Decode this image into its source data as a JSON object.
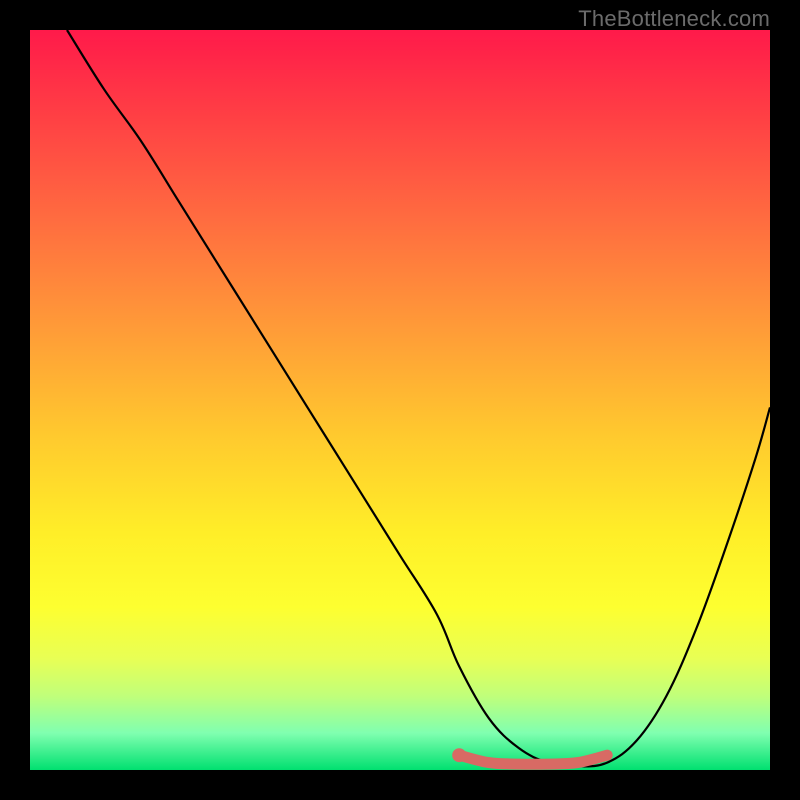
{
  "watermark": "TheBottleneck.com",
  "chart_data": {
    "type": "line",
    "title": "",
    "xlabel": "",
    "ylabel": "",
    "xlim": [
      0,
      100
    ],
    "ylim": [
      0,
      100
    ],
    "grid": false,
    "legend": false,
    "series": [
      {
        "name": "curve",
        "color": "#000000",
        "x": [
          5,
          10,
          15,
          20,
          25,
          30,
          35,
          40,
          45,
          50,
          55,
          58,
          62,
          66,
          70,
          74,
          78,
          82,
          86,
          90,
          94,
          98,
          100
        ],
        "y": [
          100,
          92,
          85,
          77,
          69,
          61,
          53,
          45,
          37,
          29,
          21,
          14,
          7,
          3,
          1,
          0.5,
          1,
          4,
          10,
          19,
          30,
          42,
          49
        ]
      },
      {
        "name": "highlight",
        "color": "#d86a64",
        "x": [
          58,
          62,
          66,
          70,
          74,
          78
        ],
        "y": [
          2,
          1,
          0.8,
          0.8,
          1,
          2
        ]
      }
    ],
    "annotations": []
  }
}
